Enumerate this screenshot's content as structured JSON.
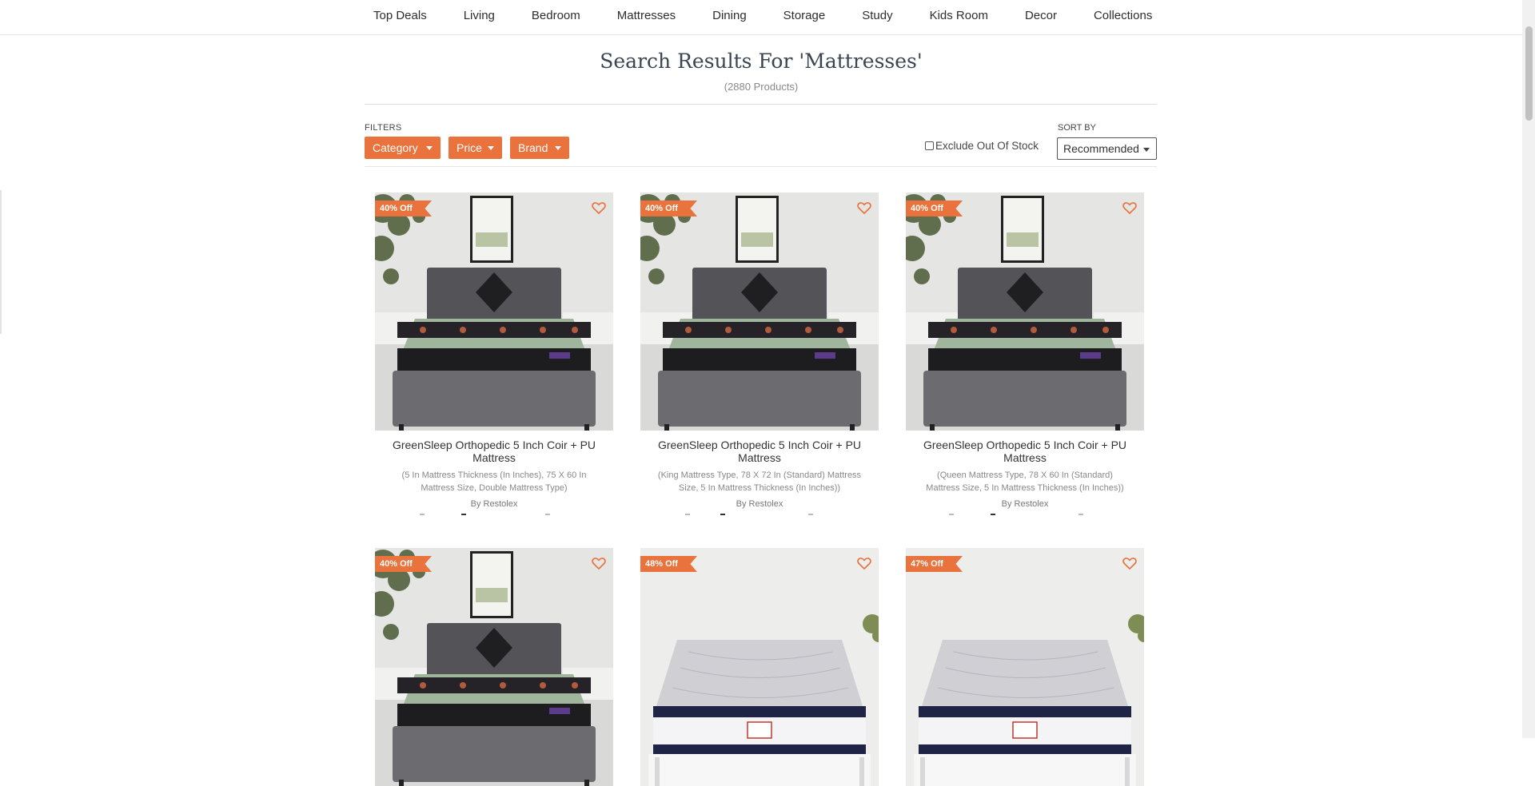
{
  "nav": {
    "items": [
      "Top Deals",
      "Living",
      "Bedroom",
      "Mattresses",
      "Dining",
      "Storage",
      "Study",
      "Kids Room",
      "Decor",
      "Collections"
    ]
  },
  "search": {
    "title": "Search Results For 'Mattresses'",
    "count": "(2880 Products)"
  },
  "filters": {
    "label": "FILTERS",
    "category": "Category",
    "price": "Price",
    "brand": "Brand",
    "exclude_label": "Exclude Out Of Stock",
    "exclude_checked": false
  },
  "sort": {
    "label": "SORT BY",
    "value": "Recommended"
  },
  "products": [
    {
      "discount": "40% Off",
      "title": "GreenSleep Orthopedic 5 Inch Coir + PU Mattress",
      "desc": "(5 In Mattress Thickness (In Inches), 75 X 60 In Mattress Size, Double Mattress Type)",
      "brand": "By Restolex",
      "image": "bed-with-green-mattress"
    },
    {
      "discount": "40% Off",
      "title": "GreenSleep Orthopedic 5 Inch Coir + PU Mattress",
      "desc": "(King Mattress Type, 78 X 72 In (Standard) Mattress Size, 5 In Mattress Thickness (In Inches))",
      "brand": "By Restolex",
      "image": "bed-with-green-mattress"
    },
    {
      "discount": "40% Off",
      "title": "GreenSleep Orthopedic 5 Inch Coir + PU Mattress",
      "desc": "(Queen Mattress Type, 78 X 60 In (Standard) Mattress Size, 5 In Mattress Thickness (In Inches))",
      "brand": "By Restolex",
      "image": "bed-with-green-mattress"
    },
    {
      "discount": "40% Off",
      "image": "bed-with-green-mattress"
    },
    {
      "discount": "48% Off",
      "image": "white-quilted-mattress"
    },
    {
      "discount": "47% Off",
      "image": "white-quilted-mattress"
    }
  ],
  "colors": {
    "accent": "#e9723d",
    "heading": "#3a4552"
  }
}
